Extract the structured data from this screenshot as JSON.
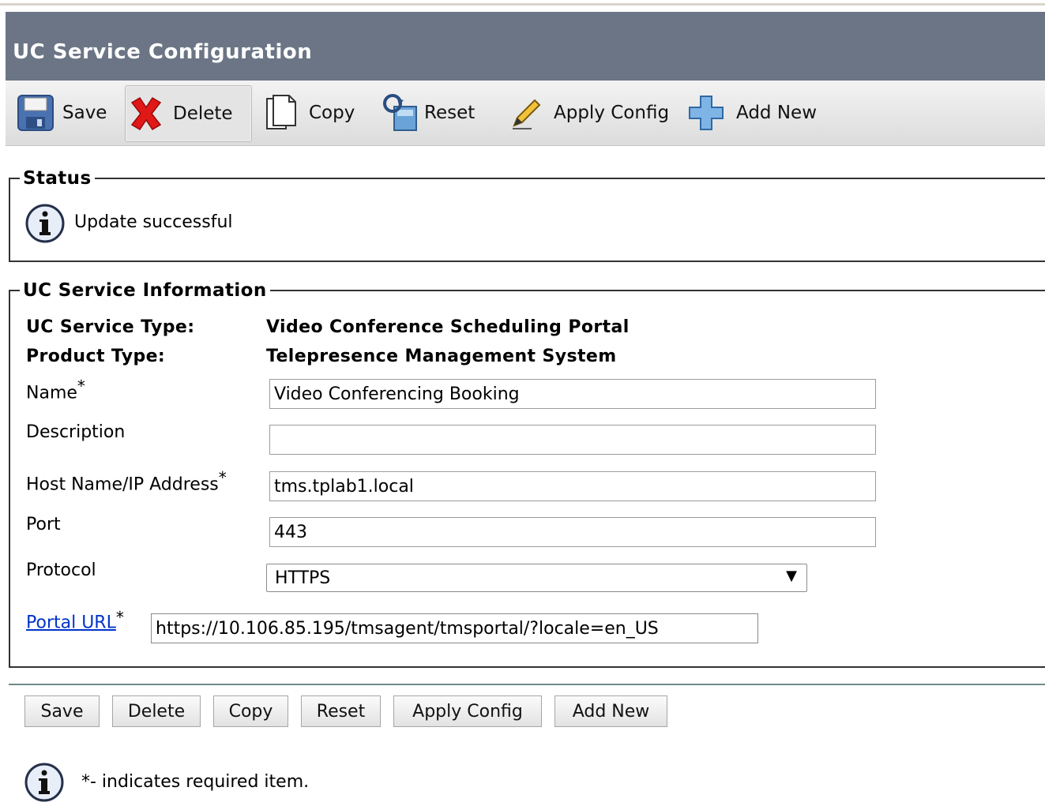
{
  "page": {
    "title": "UC Service Configuration"
  },
  "toolbar": {
    "save": "Save",
    "delete": "Delete",
    "copy": "Copy",
    "reset": "Reset",
    "apply_config": "Apply Config",
    "add_new": "Add New"
  },
  "status": {
    "legend": "Status",
    "message": "Update successful"
  },
  "info": {
    "legend": "UC Service Information",
    "service_type_label": "UC Service Type:",
    "service_type_value": "Video Conference Scheduling Portal",
    "product_type_label": "Product Type:",
    "product_type_value": "Telepresence Management System",
    "name_label": "Name",
    "name_value": "Video Conferencing Booking",
    "description_label": "Description",
    "description_value": "",
    "host_label": "Host Name/IP Address",
    "host_value": "tms.tplab1.local",
    "port_label": "Port",
    "port_value": "443",
    "protocol_label": "Protocol",
    "protocol_value": "HTTPS",
    "portal_url_label": "Portal URL",
    "portal_url_value": "https://10.106.85.195/tmsagent/tmsportal/?locale=en_US",
    "required_marker": "*"
  },
  "bottom_buttons": {
    "save": "Save",
    "delete": "Delete",
    "copy": "Copy",
    "reset": "Reset",
    "apply_config": "Apply Config",
    "add_new": "Add New"
  },
  "footer": {
    "required_note": "*- indicates required item."
  },
  "colors": {
    "title_bar": "#6b7585",
    "link": "#0033cc",
    "delete_icon": "#e01818",
    "separator": "#6d8b8a"
  }
}
